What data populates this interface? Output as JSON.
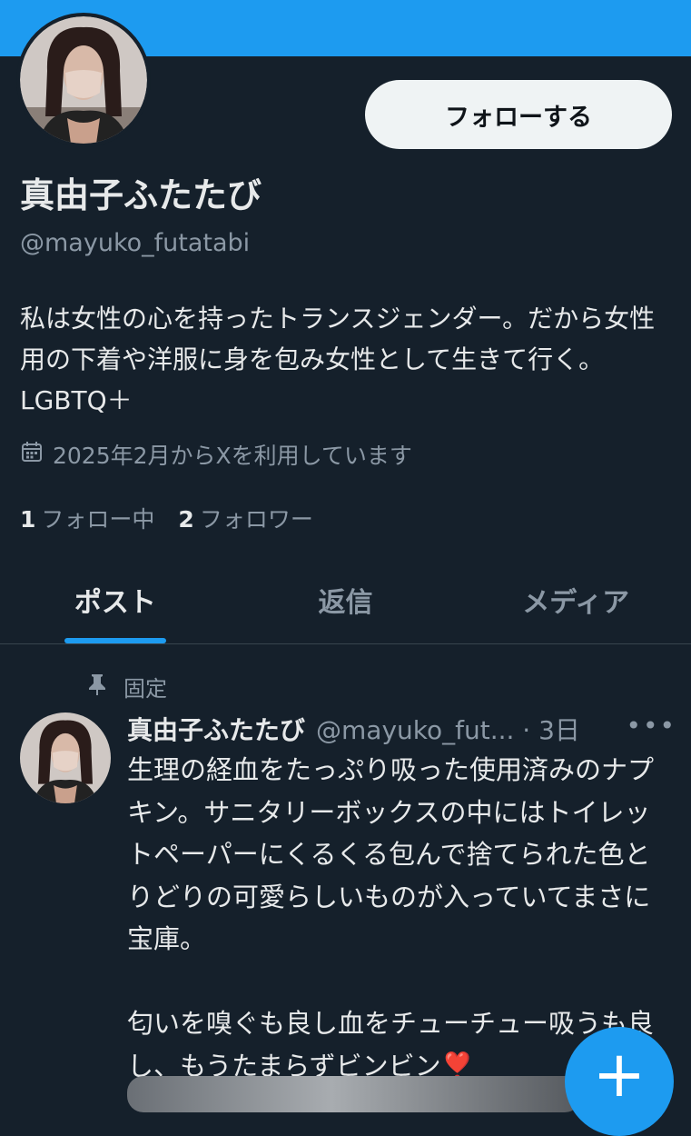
{
  "profile": {
    "follow_label": "フォローする",
    "display_name": "真由子ふたたび",
    "handle": "@mayuko_futatabi",
    "bio": "私は女性の心を持ったトランスジェンダー。だから女性用の下着や洋服に身を包み女性として生きて行く。LGBTQ＋",
    "joined": "2025年2月からXを利用しています",
    "following_count": "1",
    "following_label": "フォロー中",
    "followers_count": "2",
    "followers_label": "フォロワー"
  },
  "tabs": [
    {
      "label": "ポスト",
      "active": true
    },
    {
      "label": "返信",
      "active": false
    },
    {
      "label": "メディア",
      "active": false
    }
  ],
  "post": {
    "pinned_label": "固定",
    "name": "真由子ふたたび",
    "handle_time": "@mayuko_fut... · 3日",
    "more": "•••",
    "text": "生理の経血をたっぷり吸った使用済みのナプキン。サニタリーボックスの中にはトイレットペーパーにくるくる包んで捨てられた色とりどりの可愛らしいものが入っていてまさに宝庫。\n\n匂いを嗅ぐも良し血をチューチュー吸うも良し、もうたまらずビンビン❣️"
  },
  "fab": {
    "label": "+"
  },
  "colors": {
    "background": "#15202b",
    "accent": "#1d9bf0",
    "muted": "#8b98a5"
  }
}
